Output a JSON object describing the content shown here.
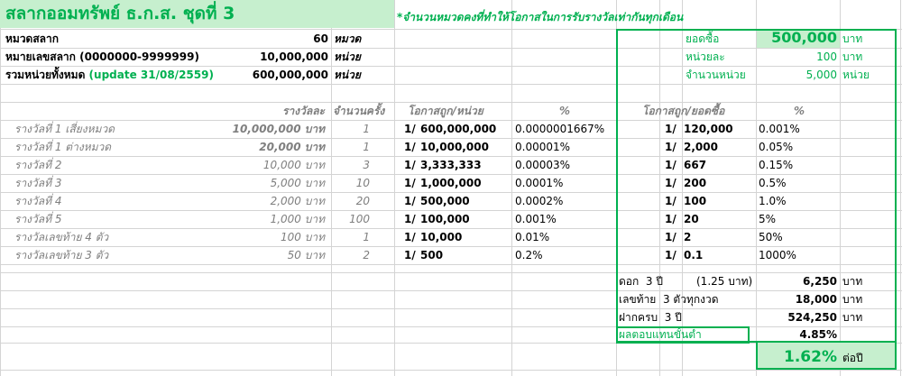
{
  "title": "สลากออมทรัพย์ ธ.ก.ส. ชุดที่ 3",
  "note": "*จำนวนหมวดคงที่ทำให้โอกาสในการรับรางวัลเท่ากันทุกเดือน",
  "info": [
    {
      "label": "หมวดสลาก",
      "value": "60",
      "unit": "หมวด"
    },
    {
      "label": "หมายเลขสลาก (0000000-9999999)",
      "value": "10,000,000",
      "unit": "หน่วย"
    },
    {
      "label": "รวมหน่วยทั้งหมด",
      "label_extra": "(update 31/08/2559)",
      "value": "600,000,000",
      "unit": "หน่วย"
    }
  ],
  "purchase": {
    "buy_label": "ยอดซื้อ",
    "buy_value": "500,000",
    "buy_unit": "บาท",
    "unit_price_label": "หน่วยละ",
    "unit_price_value": "100",
    "unit_price_unit": "บาท",
    "units_label": "จำนวนหน่วย",
    "units_value": "5,000",
    "units_unit": "หน่วย"
  },
  "headers": {
    "prize": "รางวัลละ",
    "times": "จำนวนครั้ง",
    "chance_unit": "โอกาสถูก/หน่วย",
    "pct": "%",
    "chance_buy": "โอกาสถูก/ยอดซื้อ",
    "pct2": "%"
  },
  "rows": [
    {
      "name": "รางวัลที่ 1 เสี่ยงหมวด",
      "prize": "10,000,000 บาท",
      "times": "1",
      "one": "1/",
      "chance": "600,000,000",
      "pct": "0.0000001667%",
      "one2": "1/",
      "chance2": "120,000",
      "pct2": "0.001%",
      "bold": true
    },
    {
      "name": "รางวัลที่ 1 ต่างหมวด",
      "prize": "20,000 บาท",
      "times": "1",
      "one": "1/",
      "chance": "10,000,000",
      "pct": "0.00001%",
      "one2": "1/",
      "chance2": "2,000",
      "pct2": "0.05%",
      "bold": true
    },
    {
      "name": "รางวัลที่ 2",
      "prize": "10,000 บาท",
      "times": "3",
      "one": "1/",
      "chance": "3,333,333",
      "pct": "0.00003%",
      "one2": "1/",
      "chance2": "667",
      "pct2": "0.15%",
      "bold": false
    },
    {
      "name": "รางวัลที่ 3",
      "prize": "5,000 บาท",
      "times": "10",
      "one": "1/",
      "chance": "1,000,000",
      "pct": "0.0001%",
      "one2": "1/",
      "chance2": "200",
      "pct2": "0.5%",
      "bold": false
    },
    {
      "name": "รางวัลที่ 4",
      "prize": "2,000 บาท",
      "times": "20",
      "one": "1/",
      "chance": "500,000",
      "pct": "0.0002%",
      "one2": "1/",
      "chance2": "100",
      "pct2": "1.0%",
      "bold": false
    },
    {
      "name": "รางวัลที่ 5",
      "prize": "1,000 บาท",
      "times": "100",
      "one": "1/",
      "chance": "100,000",
      "pct": "0.001%",
      "one2": "1/",
      "chance2": "20",
      "pct2": "5%",
      "bold": false
    },
    {
      "name": "รางวัลเลขท้าย 4 ตัว",
      "prize": "100 บาท",
      "times": "1",
      "one": "1/",
      "chance": "10,000",
      "pct": "0.01%",
      "one2": "1/",
      "chance2": "2",
      "pct2": "50%",
      "bold": false
    },
    {
      "name": "รางวัลเลขท้าย 3 ตัว",
      "prize": "50 บาท",
      "times": "2",
      "one": "1/",
      "chance": "500",
      "pct": "0.2%",
      "one2": "1/",
      "chance2": "0.1",
      "pct2": "1000%",
      "bold": false
    }
  ],
  "summary": {
    "interest_label": "ดอก",
    "interest_years": "3 ปี",
    "interest_note": "(1.25 บาท)",
    "interest_value": "6,250",
    "interest_unit": "บาท",
    "last_label": "เลขท้าย",
    "last_note": "3 ตัวทุกงวด",
    "last_value": "18,000",
    "last_unit": "บาท",
    "total_label": "ฝากครบ",
    "total_years": "3 ปี",
    "total_value": "524,250",
    "total_unit": "บาท",
    "min_label": "ผลตอบแทนขั้นต่ำ",
    "min_value": "4.85%",
    "annual_value": "1.62%",
    "annual_unit": "ต่อปี"
  },
  "colors": {
    "accent_green": "#00b050",
    "light_green": "#c6efce",
    "grid": "#d4d4d4",
    "gray_text": "#7f7f7f"
  }
}
